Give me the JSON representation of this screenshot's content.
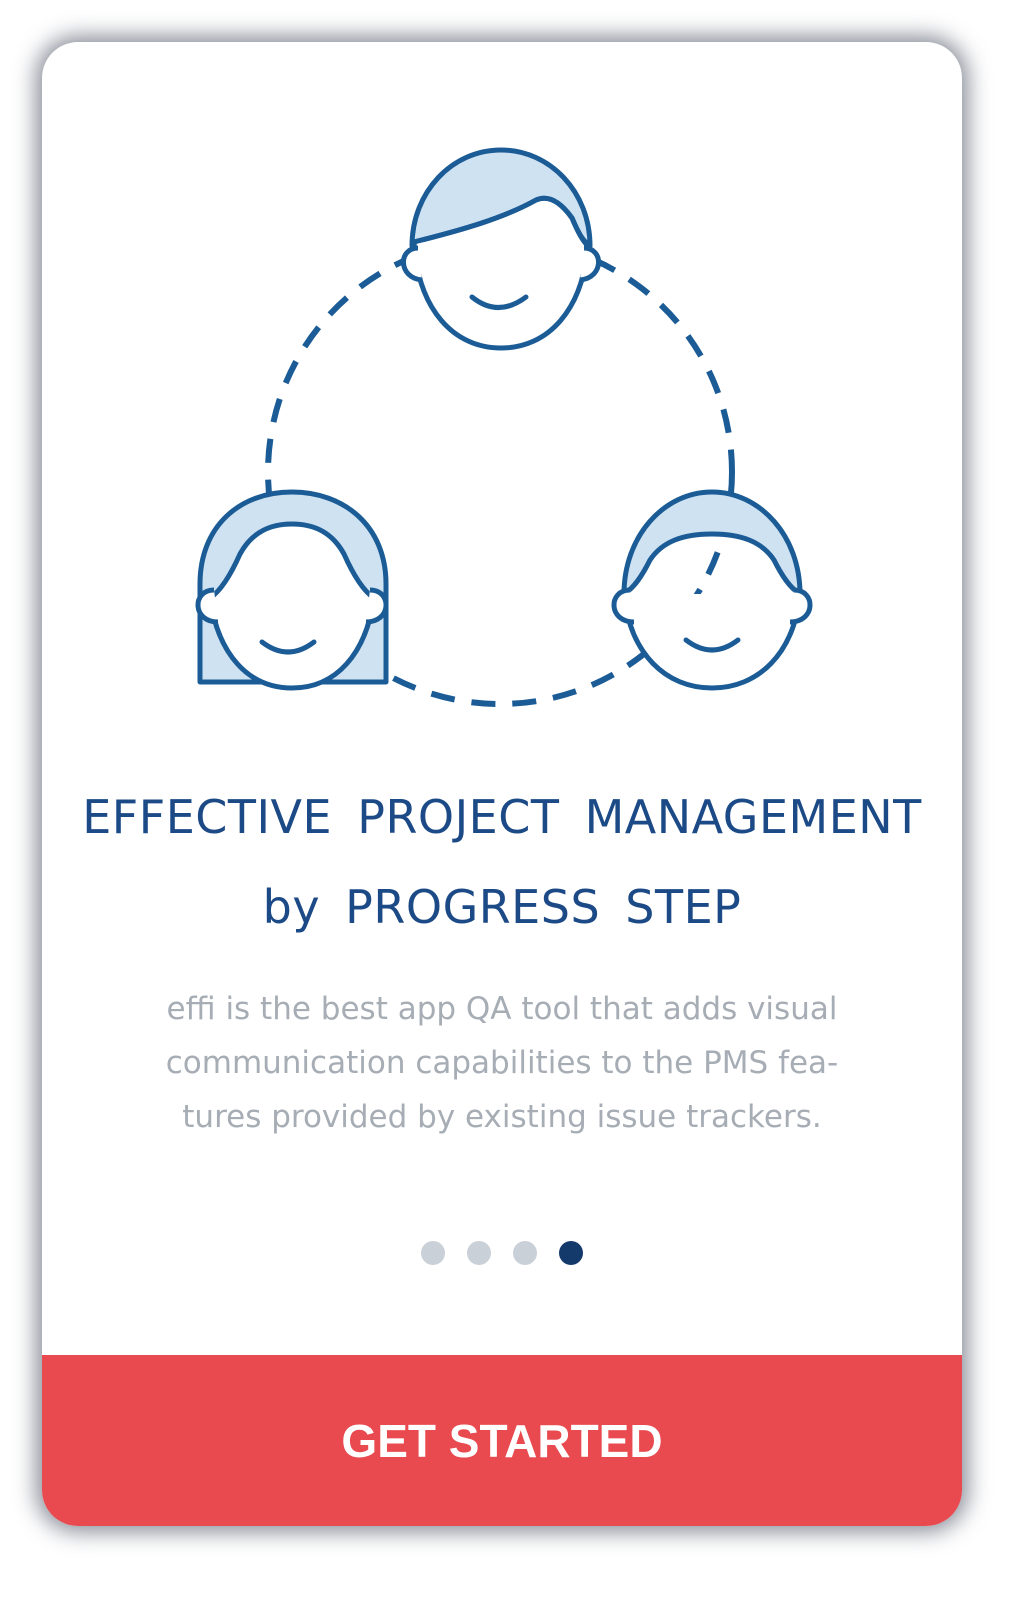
{
  "illustration": {
    "icon": "team-people-icon",
    "stroke_color": "#1c5c96",
    "fill_color": "#cfe2f1"
  },
  "title": {
    "line1": "EFFECTIVE PROJECT MANAGEMENT",
    "line2": "by PROGRESS STEP"
  },
  "description": {
    "line1": "effi is the best app QA tool that adds visual",
    "line2": "communication capabilities to the PMS fea-",
    "line3": "tures provided by existing issue trackers."
  },
  "pagination": {
    "total": 4,
    "active_index": 3
  },
  "cta": {
    "label": "GET STARTED",
    "color": "#e84a4f"
  }
}
